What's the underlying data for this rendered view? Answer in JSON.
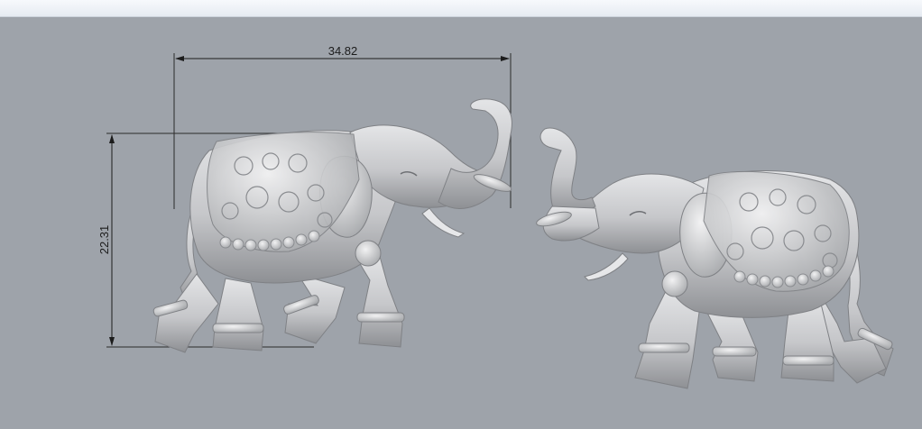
{
  "viewport": {
    "background": "#9ea3aa",
    "model_color": "#c9cacc"
  },
  "dimensions": {
    "width_label": "34.82",
    "height_label": "22.31"
  },
  "models": [
    {
      "name": "elephant-left",
      "facing": "right"
    },
    {
      "name": "elephant-right",
      "facing": "left"
    }
  ]
}
